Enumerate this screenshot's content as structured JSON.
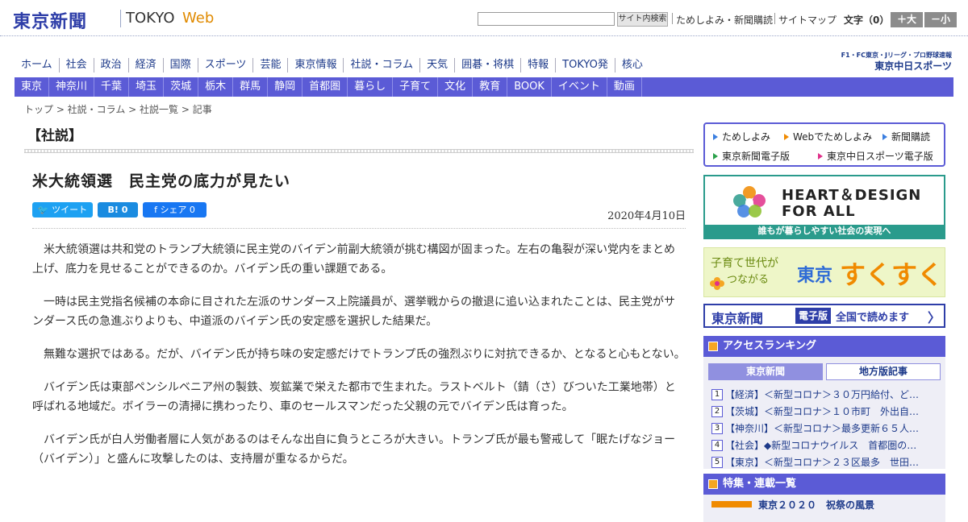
{
  "header": {
    "logo_kanji": "東京新聞",
    "logo_tokyo": "TOKYO",
    "logo_web": "Web",
    "search_button": "サイト内検索",
    "link_trial": "ためしよみ・新聞購読",
    "link_sitemap": "サイトマップ",
    "fontsize_label": "文字（0）",
    "size_up": "＋大",
    "size_down": "－小"
  },
  "global_nav": [
    "ホーム",
    "社会",
    "政治",
    "経済",
    "国際",
    "スポーツ",
    "芸能",
    "東京情報",
    "社説・コラム",
    "天気",
    "囲碁・将棋",
    "特報",
    "TOKYO発",
    "核心"
  ],
  "chunichi": {
    "sub": "F1・FC東京・Jリーグ・プロ野球速報",
    "main": "東京中日スポーツ"
  },
  "local_nav": [
    "東京",
    "神奈川",
    "千葉",
    "埼玉",
    "茨城",
    "栃木",
    "群馬",
    "静岡",
    "首都圏",
    "暮らし",
    "子育て",
    "文化",
    "教育",
    "BOOK",
    "イベント",
    "動画"
  ],
  "breadcrumb": "トップ > 社説・コラム > 社説一覧 > 記事",
  "article": {
    "section": "【社説】",
    "headline": "米大統領選　民主党の底力が見たい",
    "tweet": "ツイート",
    "hatena": "B! 0",
    "share": "シェア 0",
    "date": "2020年4月10日",
    "paragraphs": [
      "米大統領選は共和党のトランプ大統領に民主党のバイデン前副大統領が挑む構図が固まった。左右の亀裂が深い党内をまとめ上げ、底力を見せることができるのか。バイデン氏の重い課題である。",
      "一時は民主党指名候補の本命に目された左派のサンダース上院議員が、選挙戦からの撤退に追い込まれたことは、民主党がサンダース氏の急進ぶりよりも、中道派のバイデン氏の安定感を選択した結果だ。",
      "無難な選択ではある。だが、バイデン氏が持ち味の安定感だけでトランプ氏の強烈ぶりに対抗できるか、となると心もとない。",
      "バイデン氏は東部ペンシルベニア州の製鉄、炭鉱業で栄えた都市で生まれた。ラストベルト（錆（さ）びついた工業地帯）と呼ばれる地域だ。ボイラーの清掃に携わったり、車のセールスマンだった父親の元でバイデン氏は育った。",
      "バイデン氏が白人労働者層に人気があるのはそんな出自に負うところが大きい。トランプ氏が最も警戒して「眠たげなジョー（バイデン）」と盛んに攻撃したのは、支持層が重なるからだ。"
    ]
  },
  "sidebar": {
    "promo": [
      "ためしよみ",
      "Webでためしよみ",
      "新聞購読",
      "東京新聞電子版",
      "東京中日スポーツ電子版"
    ],
    "heart_title1": "HEART＆DESIGN",
    "heart_title2": "FOR ALL",
    "heart_sub": "誰もが暮らしやすい社会の実現へ",
    "sukusuku_sub1": "子育て世代が",
    "sukusuku_sub2": "つながる",
    "sukusuku_tokyo": "東京",
    "sukusuku_main": "すくすく",
    "denshiban_logo": "東京新聞",
    "denshiban_badge": "電子版",
    "denshiban_text": "全国で読めます",
    "denshiban_arrow": "〉",
    "ranking_title": "アクセスランキング",
    "ranking_tab_tokyo": "東京新聞",
    "ranking_tab_local": "地方版記事",
    "ranking_items": [
      {
        "num": "1",
        "text": "【経済】＜新型コロナ＞３０万円給付、ど…"
      },
      {
        "num": "2",
        "text": "【茨城】＜新型コロナ＞１０市町　外出自…"
      },
      {
        "num": "3",
        "text": "【神奈川】＜新型コロナ＞最多更新６５人…"
      },
      {
        "num": "4",
        "text": "【社会】◆新型コロナウイルス　首都圏の…"
      },
      {
        "num": "5",
        "text": "【東京】＜新型コロナ＞２３区最多　世田…"
      }
    ],
    "feature_title": "特集・連載一覧",
    "feature_peek": "東京２０２０　祝祭の風景"
  },
  "colors": {
    "brand": "#2e3ea8",
    "nav_bar": "#5b5bd6",
    "accent_orange": "#f08a00",
    "heart_green": "#2a9b8c"
  }
}
